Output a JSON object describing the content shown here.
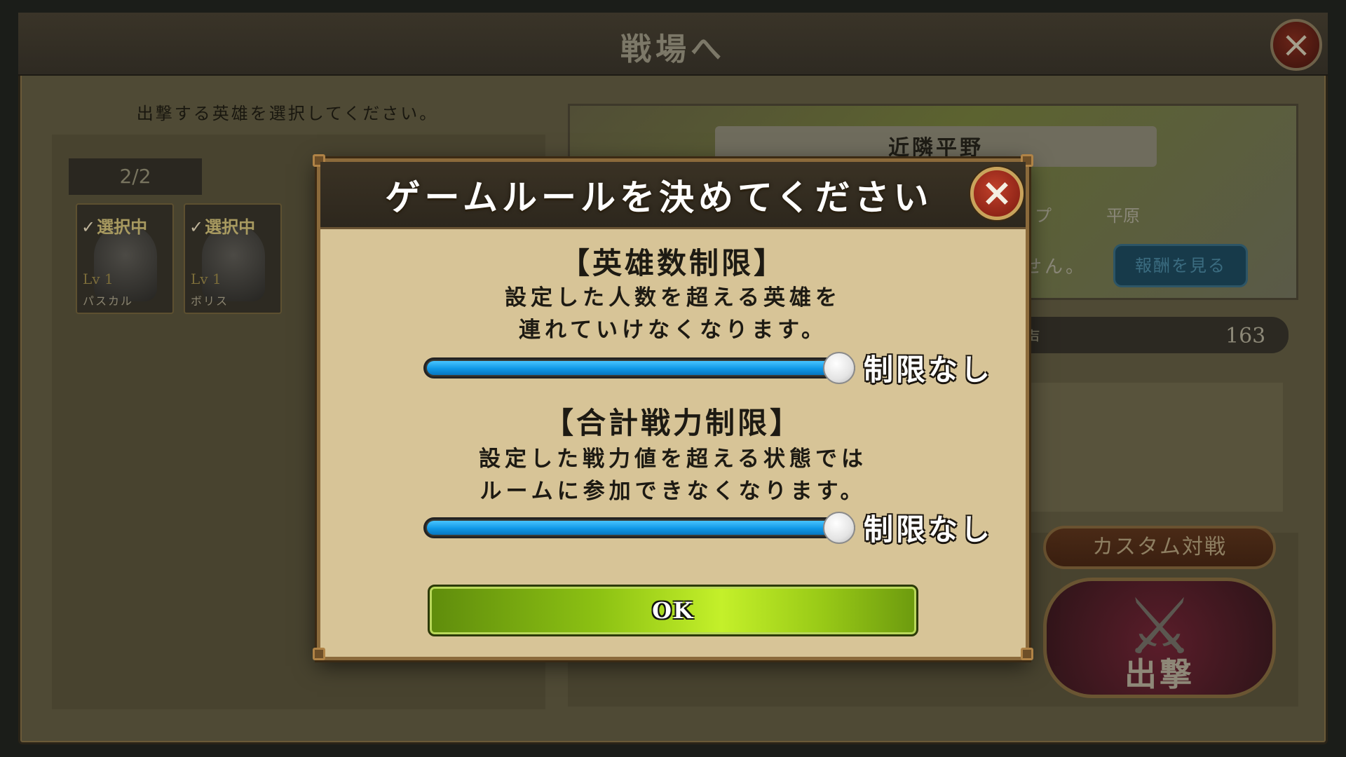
{
  "screen": {
    "title": "戦場へ",
    "close_icon": "×",
    "instruction": "出撃する英雄を選択してください。"
  },
  "hero_selection": {
    "count": "2/2",
    "heroes": [
      {
        "selected_label": "選択中",
        "level": "Lv 1",
        "name": "パスカル"
      },
      {
        "selected_label": "選択中",
        "level": "Lv 1",
        "name": "ボリス"
      }
    ]
  },
  "stage": {
    "name": "近隣平野",
    "type_label": "イプ",
    "type_value": "平原",
    "note": "せん。",
    "reward_button": "報酬を見る",
    "stat_label": "声",
    "stat_value": "163"
  },
  "actions": {
    "custom_battle": "カスタム対戦",
    "sortie": "出撃"
  },
  "modal": {
    "title": "ゲームルールを決めてください",
    "close_icon": "×",
    "hero_limit": {
      "title": "【英雄数制限】",
      "desc_line1": "設定した人数を超える英雄を",
      "desc_line2": "連れていけなくなります。",
      "value_label": "制限なし",
      "slider_level": 1.0
    },
    "power_limit": {
      "title": "【合計戦力制限】",
      "desc_line1": "設定した戦力値を超える状態では",
      "desc_line2": "ルームに参加できなくなります。",
      "value_label": "制限なし",
      "slider_level": 1.0
    },
    "ok_label": "OK"
  },
  "colors": {
    "modal_bg": "#d7c497",
    "slider_fill": "#1098e6",
    "ok_button": "#9acb17",
    "close_button": "#c0402a"
  }
}
